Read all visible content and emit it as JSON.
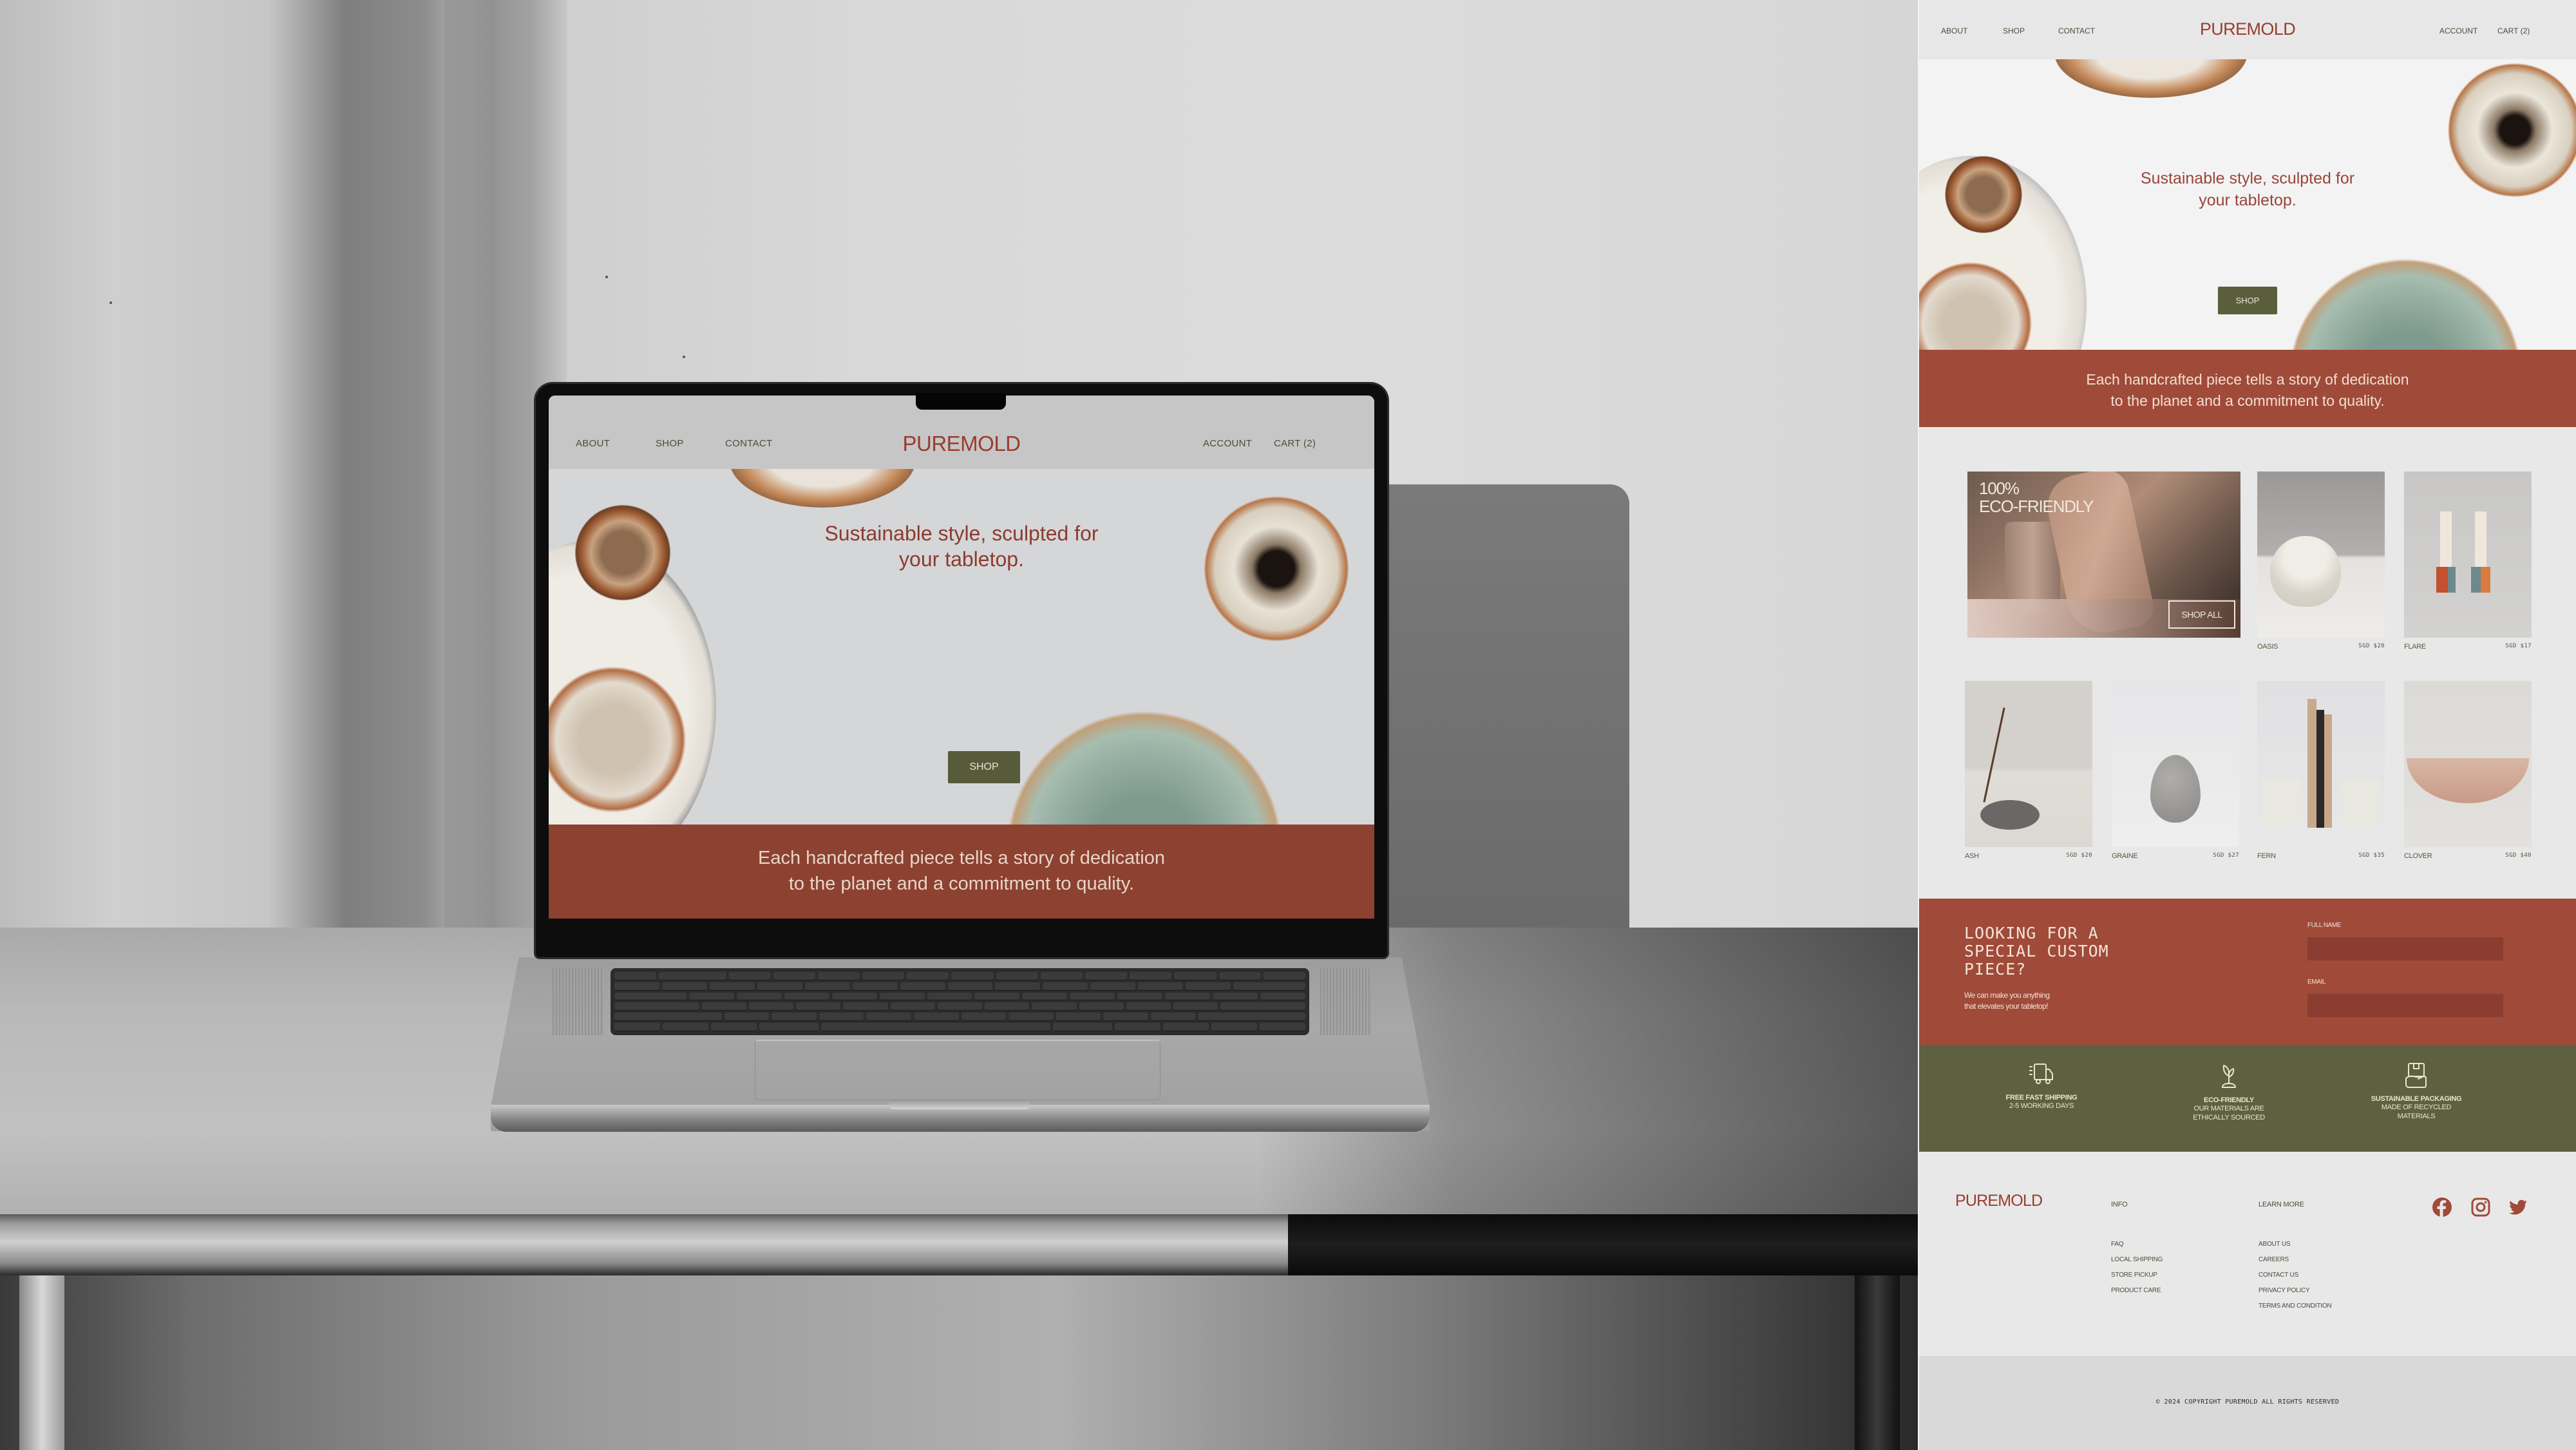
{
  "brand": {
    "name": "PUREMOLD",
    "colors": {
      "terracotta": "#a04a39",
      "olive": "#5e6140",
      "background": "#e8e8e8",
      "text_dark": "#4c4d3a"
    }
  },
  "header": {
    "nav_left": [
      "ABOUT",
      "SHOP",
      "CONTACT"
    ],
    "logo": "PUREMOLD",
    "nav_right": [
      "ACCOUNT",
      "CART (2)"
    ]
  },
  "hero": {
    "title_line1": "Sustainable style, sculpted for",
    "title_line2": "your tabletop.",
    "cta": "SHOP"
  },
  "tagline": {
    "line1": "Each handcrafted piece tells a story of dedication",
    "line2": "to the planet and a commitment to quality."
  },
  "featured": {
    "title_line1": "100%",
    "title_line2": "ECO-FRIENDLY",
    "cta": "SHOP ALL"
  },
  "products": [
    {
      "name": "OASIS",
      "price": "SGD $20"
    },
    {
      "name": "FLARE",
      "price": "SGD $17"
    },
    {
      "name": "ASH",
      "price": "SGD $20"
    },
    {
      "name": "GRAINE",
      "price": "SGD $27"
    },
    {
      "name": "FERN",
      "price": "SGD $35"
    },
    {
      "name": "CLOVER",
      "price": "SGD $40"
    }
  ],
  "custom": {
    "title_line1": "LOOKING FOR A",
    "title_line2": "SPECIAL CUSTOM",
    "title_line3": "PIECE?",
    "sub_line1": "We can make you anything",
    "sub_line2": "that elevates your tabletop!",
    "fields": [
      {
        "label": "FULL NAME",
        "value": ""
      },
      {
        "label": "EMAIL",
        "value": ""
      }
    ]
  },
  "features": [
    {
      "icon": "truck-icon",
      "title": "FREE FAST SHIPPING",
      "lines": [
        "2-5 WORKING DAYS"
      ]
    },
    {
      "icon": "sprout-icon",
      "title": "ECO-FRIENDLY",
      "lines": [
        "OUR MATERIALS ARE",
        "ETHICALLY SOURCED"
      ]
    },
    {
      "icon": "hand-box-icon",
      "title": "SUSTAINABLE PACKAGING",
      "lines": [
        "MADE OF RECYCLED",
        "MATERIALS"
      ]
    }
  ],
  "footer": {
    "logo": "PUREMOLD",
    "info": {
      "title": "INFO",
      "links": [
        "FAQ",
        "LOCAL SHIPPING",
        "STORE PICKUP",
        "PRODUCT CARE"
      ]
    },
    "learn_more": {
      "title": "LEARN MORE",
      "links": [
        "ABOUT US",
        "CAREERS",
        "CONTACT US",
        "PRIVACY POLICY",
        "TERMS AND CONDITION"
      ]
    },
    "social": [
      "facebook-icon",
      "instagram-icon",
      "twitter-icon"
    ],
    "copyright": "© 2024 COPYRIGHT PUREMOLD ALL RIGHTS RESERVED"
  }
}
